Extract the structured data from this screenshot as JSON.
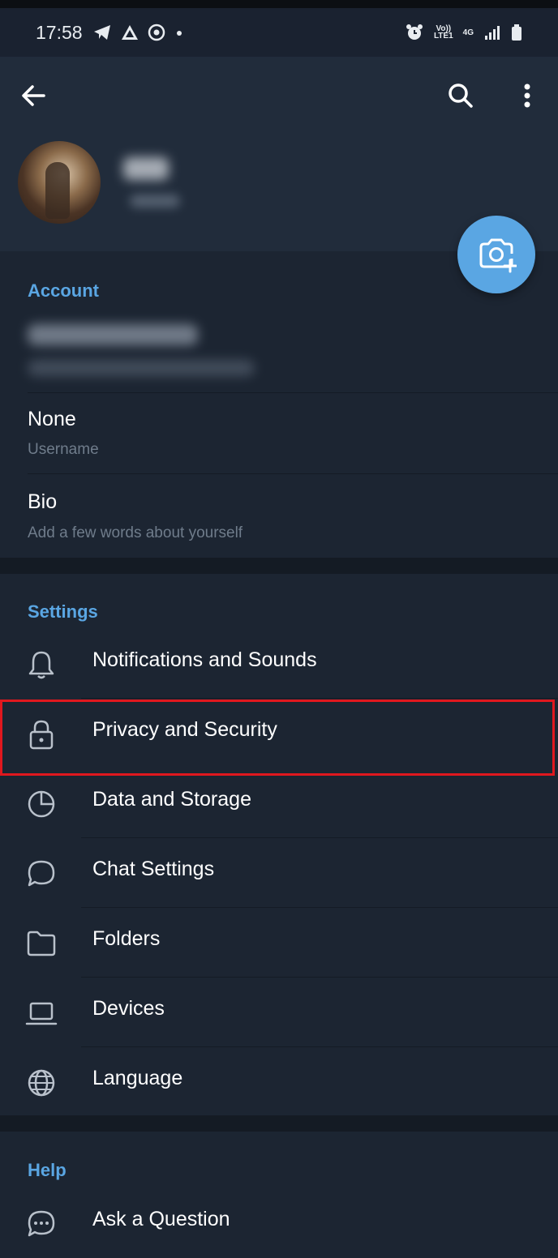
{
  "status_bar": {
    "time": "17:58",
    "left_icons": [
      "telegram-icon",
      "drive-icon",
      "location-icon",
      "dot-icon"
    ],
    "network_labels": [
      "Vo))",
      "LTE1",
      "4G"
    ],
    "right_icons": [
      "alarm-icon",
      "signal-icon",
      "battery-icon"
    ]
  },
  "header": {
    "icons": [
      "back-arrow-icon",
      "search-icon",
      "more-vertical-icon"
    ]
  },
  "account": {
    "section_title": "Account",
    "username_value": "None",
    "username_label": "Username",
    "bio_title": "Bio",
    "bio_placeholder": "Add a few words about yourself"
  },
  "settings": {
    "section_title": "Settings",
    "items": [
      {
        "label": "Notifications and Sounds",
        "icon": "bell-icon"
      },
      {
        "label": "Privacy and Security",
        "icon": "lock-icon"
      },
      {
        "label": "Data and Storage",
        "icon": "pie-chart-icon"
      },
      {
        "label": "Chat Settings",
        "icon": "chat-bubble-icon"
      },
      {
        "label": "Folders",
        "icon": "folder-icon"
      },
      {
        "label": "Devices",
        "icon": "laptop-icon"
      },
      {
        "label": "Language",
        "icon": "globe-icon"
      }
    ]
  },
  "help": {
    "section_title": "Help",
    "items": [
      {
        "label": "Ask a Question",
        "icon": "chat-dots-icon"
      }
    ]
  },
  "colors": {
    "accent": "#5aa6e3",
    "background": "#1c2532",
    "header_background": "#212c3b",
    "highlight_border": "#e0181e"
  }
}
